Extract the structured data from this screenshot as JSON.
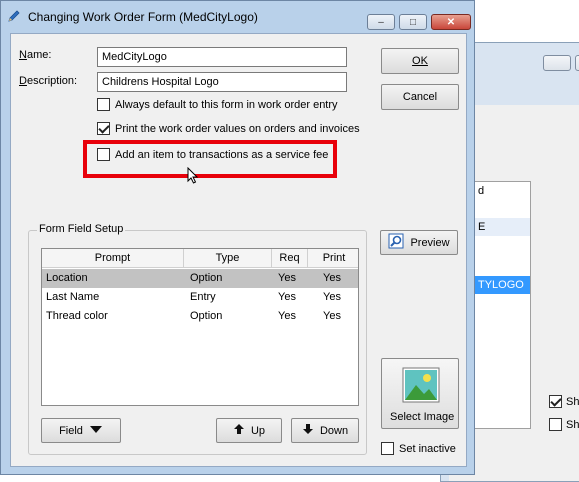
{
  "dialog": {
    "title": "Changing Work Order Form  (MedCityLogo)",
    "minimize_label": "–",
    "maximize_label": "□",
    "close_label": "✕"
  },
  "form": {
    "name_label": "Name:",
    "name_value": "MedCityLogo",
    "description_label": "Description:",
    "description_value": "Childrens Hospital Logo",
    "checkboxes": [
      {
        "label": "Always default to this form in work order entry",
        "checked": false
      },
      {
        "label": "Print the work order values on orders and invoices",
        "checked": true
      },
      {
        "label": "Add an item to transactions as a service fee",
        "checked": false
      }
    ]
  },
  "buttons": {
    "ok": "OK",
    "cancel": "Cancel",
    "preview": "Preview",
    "select_image": "Select Image",
    "set_inactive": "Set inactive",
    "field": "Field",
    "up": "Up",
    "down": "Down"
  },
  "form_field_setup": {
    "title": "Form Field Setup",
    "columns": [
      "Prompt",
      "Type",
      "Req",
      "Print"
    ],
    "rows": [
      {
        "prompt": "Location",
        "type": "Option",
        "req": "Yes",
        "print": "Yes",
        "selected": true
      },
      {
        "prompt": "Last Name",
        "type": "Entry",
        "req": "Yes",
        "print": "Yes",
        "selected": false
      },
      {
        "prompt": "Thread color",
        "type": "Option",
        "req": "Yes",
        "print": "Yes",
        "selected": false
      }
    ]
  },
  "background_window": {
    "list_items": [
      "d",
      "",
      "E",
      "",
      "",
      "TYLOGO"
    ],
    "check1_label": "Sho",
    "check2_label": "Sho"
  },
  "colors": {
    "title_bar": "#b9d1ea",
    "highlight": "#e8000a",
    "selection": "#3399ff"
  }
}
